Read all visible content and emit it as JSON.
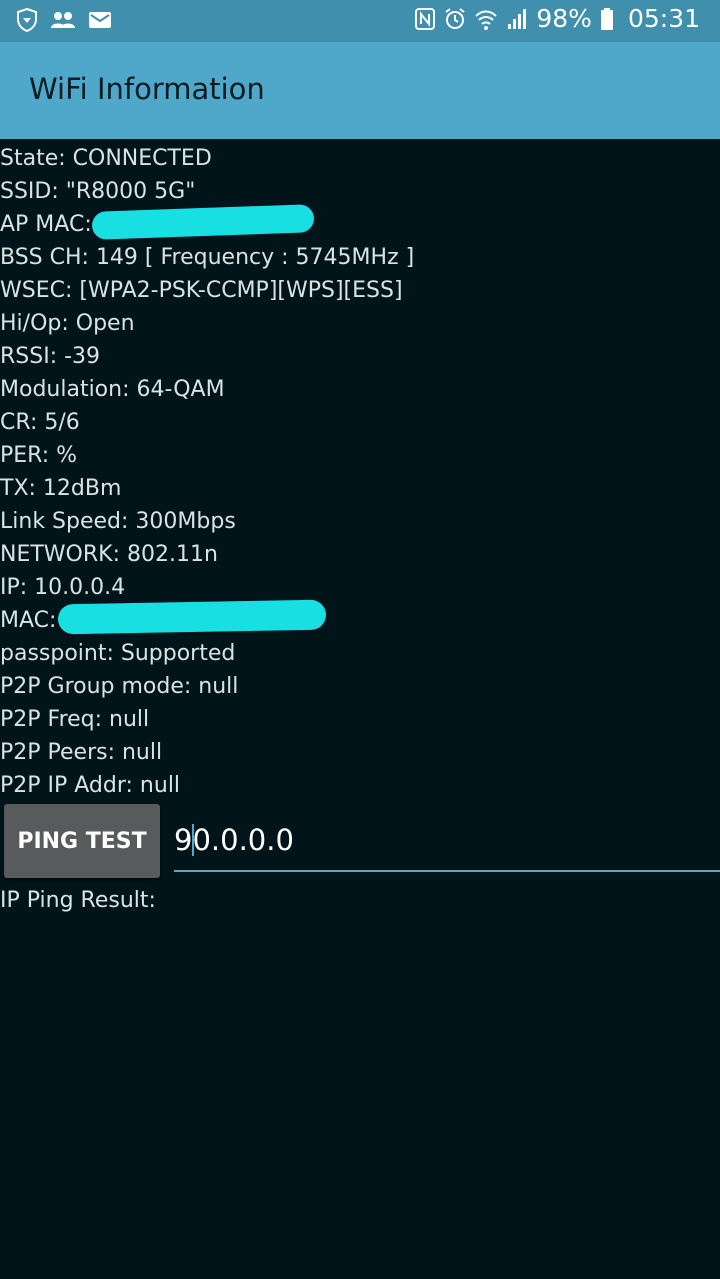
{
  "status_bar": {
    "left_icons": [
      "shield-icon",
      "people-icon",
      "mail-icon"
    ],
    "right_icons": [
      "nfc-icon",
      "alarm-icon",
      "wifi-icon",
      "signal-icon"
    ],
    "battery": "98%",
    "time": "05:31"
  },
  "app_bar": {
    "title": "WiFi Information"
  },
  "info": {
    "state": "State: CONNECTED",
    "ssid": "SSID: \"R8000 5G\"",
    "ap_mac": "AP MAC:",
    "bss_ch": "BSS CH: 149  [ Frequency : 5745MHz ]",
    "wsec": "WSEC: [WPA2-PSK-CCMP][WPS][ESS]",
    "hiop": "Hi/Op: Open",
    "rssi": "RSSI: -39",
    "modulation": "Modulation: 64-QAM",
    "cr": "CR: 5/6",
    "per": "PER:  %",
    "tx": "TX: 12dBm",
    "link_speed": "Link Speed: 300Mbps",
    "network": "NETWORK: 802.11n",
    "ip": "IP: 10.0.0.4",
    "mac": "MAC:",
    "passpoint": "passpoint: Supported",
    "p2p_group": "P2P Group mode: null",
    "p2p_freq": "P2P Freq: null",
    "p2p_peers": "P2P Peers: null",
    "p2p_ip": "P2P IP Addr: null"
  },
  "ping": {
    "button_label": "PING TEST",
    "input_value": "90.0.0.0",
    "result_label": "IP Ping Result:"
  },
  "colors": {
    "status_bar": "#3f8fad",
    "app_bar": "#4fa8c9",
    "background": "#00141a",
    "redaction": "#18e0e2",
    "button": "#595a5c"
  }
}
